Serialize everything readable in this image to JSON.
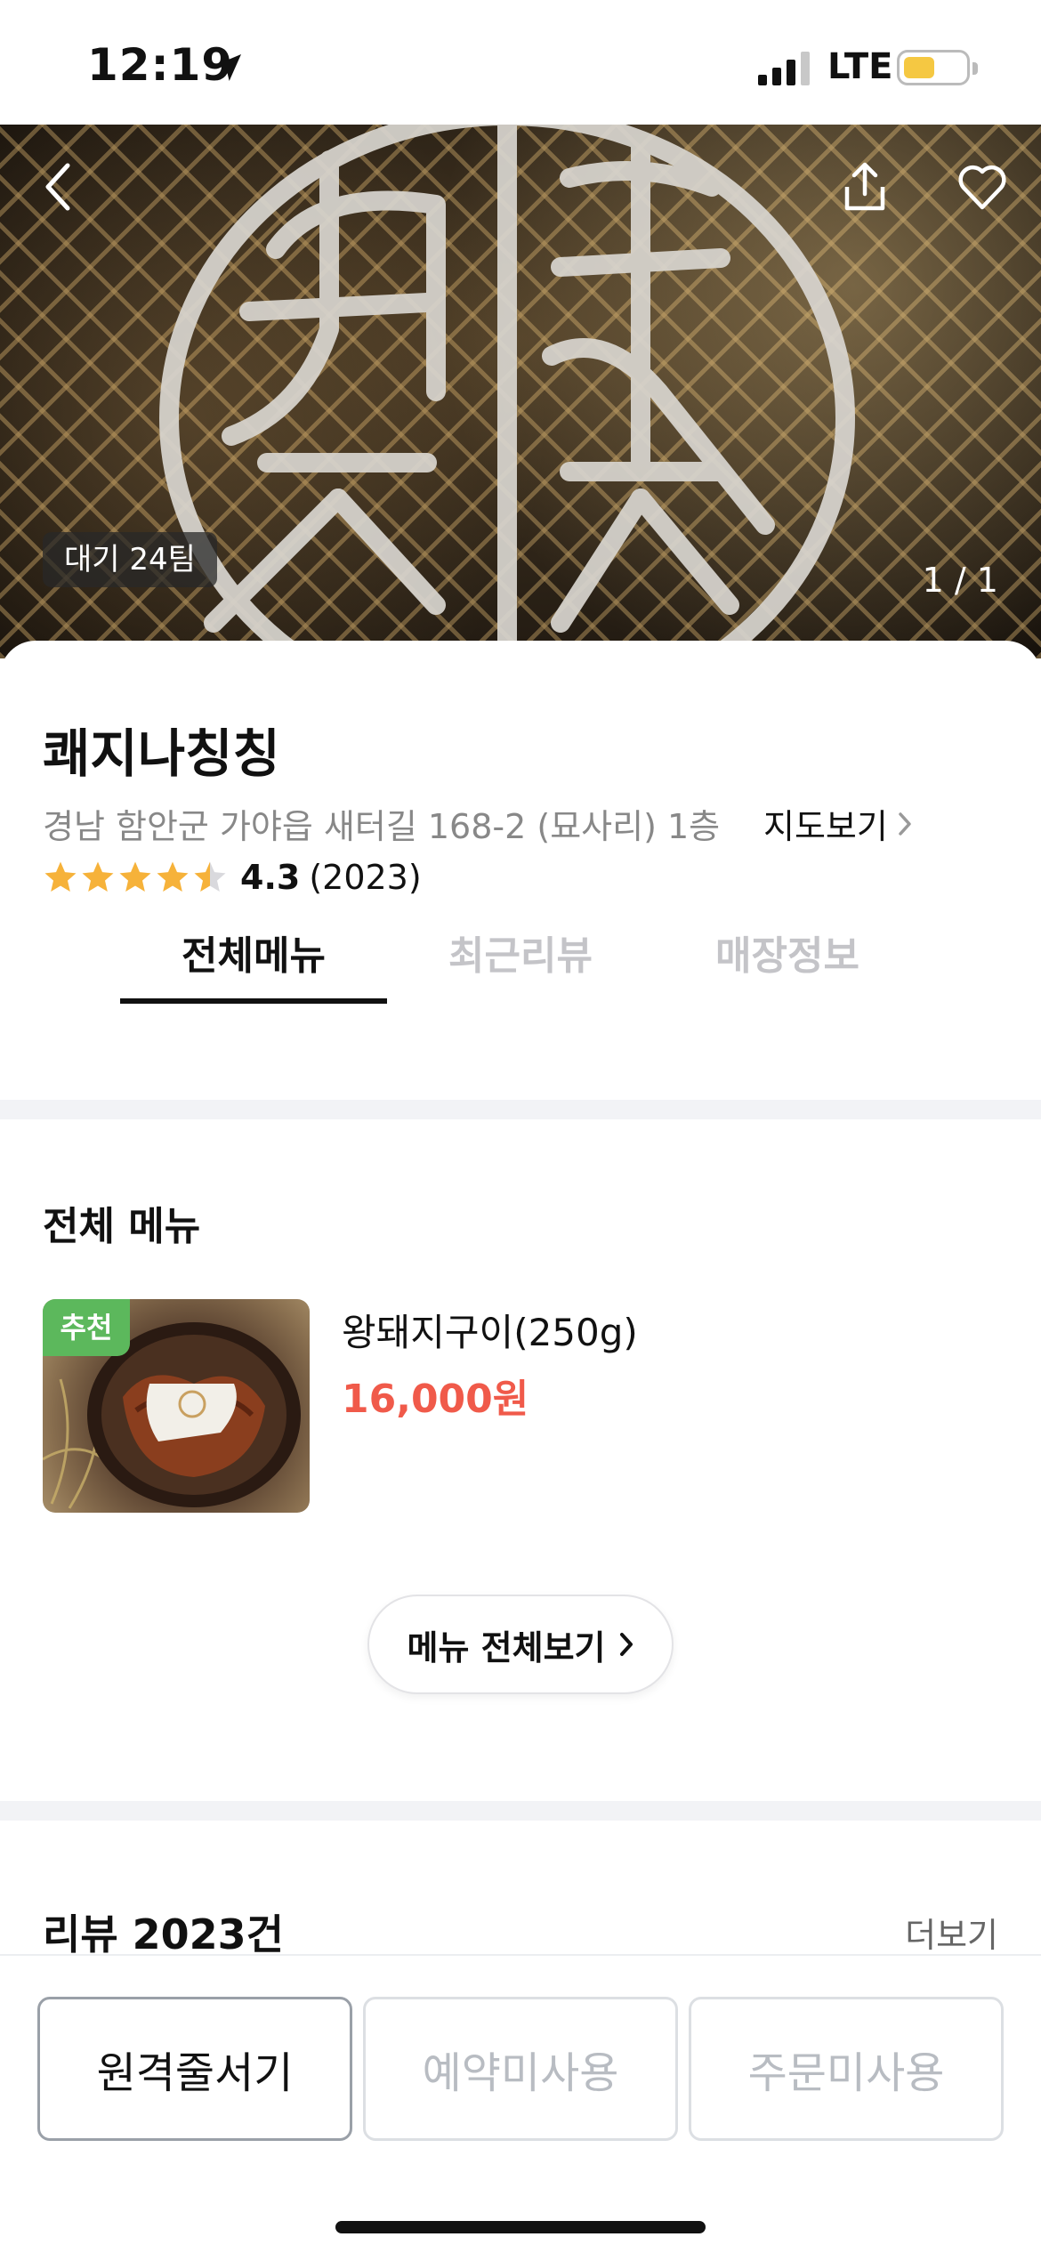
{
  "status_bar": {
    "time": "12:19",
    "network": "LTE",
    "battery_color": "#f5c842"
  },
  "hero": {
    "wait_badge": "대기 24팀",
    "photo_counter": "1 / 1",
    "icons": [
      "back-icon",
      "share-icon",
      "heart-icon"
    ]
  },
  "store": {
    "name": "쾌지나칭칭",
    "address": "경남 함안군 가야읍 새터길 168-2 (묘사리) 1층",
    "map_link": "지도보기",
    "rating": "4.3",
    "review_count": "(2023)",
    "rating_value": 4.3
  },
  "tabs": [
    {
      "label": "전체메뉴",
      "active": true
    },
    {
      "label": "최근리뷰",
      "active": false
    },
    {
      "label": "매장정보",
      "active": false
    }
  ],
  "menu_section": {
    "title": "전체 메뉴",
    "items": [
      {
        "badge": "추천",
        "name": "왕돼지구이(250g)",
        "price": "16,000원"
      }
    ],
    "view_all": "메뉴 전체보기"
  },
  "review_section": {
    "title": "리뷰 2023건",
    "more": "더보기"
  },
  "bottom_bar": {
    "buttons": [
      {
        "label": "원격줄서기",
        "enabled": true
      },
      {
        "label": "예약미사용",
        "enabled": false
      },
      {
        "label": "주문미사용",
        "enabled": false
      }
    ]
  },
  "colors": {
    "price": "#f05a4a",
    "recommend_badge": "#5cb85c",
    "star": "#f6b23a"
  }
}
